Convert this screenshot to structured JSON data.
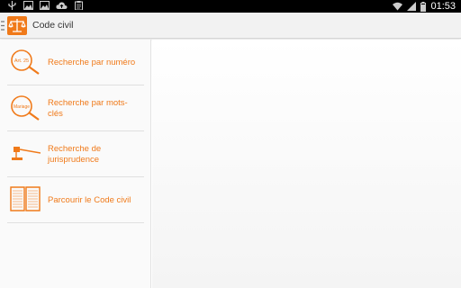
{
  "status_bar": {
    "time": "01:53",
    "left_icons": [
      "usb-icon",
      "image-icon",
      "image-icon",
      "cloud-upload-icon",
      "clipboard-icon"
    ],
    "right_icons": [
      "wifi-icon",
      "signal-icon",
      "battery-icon"
    ]
  },
  "action_bar": {
    "title": "Code civil",
    "logo_icon": "scales-of-justice-icon",
    "accent": "#f07a1a"
  },
  "menu": {
    "items": [
      {
        "label": "Recherche par numéro",
        "icon": "magnifier-article-icon",
        "icon_text": "Art. 25"
      },
      {
        "label": "Recherche par mots-clés",
        "icon": "magnifier-keyword-icon",
        "icon_text": "Mariage"
      },
      {
        "label": "Recherche de jurisprudence",
        "icon": "gavel-icon"
      },
      {
        "label": "Parcourir le Code civil",
        "icon": "open-book-icon"
      }
    ]
  },
  "colors": {
    "accent": "#f07a1a",
    "status_bar": "#000000",
    "action_bar": "#f2f2f2"
  }
}
